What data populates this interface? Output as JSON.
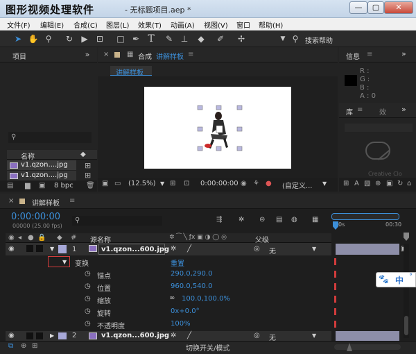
{
  "app_title": "图形视频处理软件",
  "doc_title": "- 无标题项目.aep *",
  "window_controls": {
    "minimize": "—",
    "maximize": "▢",
    "close": "✕"
  },
  "menu": [
    "文件(F)",
    "编辑(E)",
    "合成(C)",
    "图层(L)",
    "效果(T)",
    "动画(A)",
    "视图(V)",
    "窗口",
    "帮助(H)"
  ],
  "toolbar": {
    "search_help": "搜索帮助"
  },
  "project_panel": {
    "tab": "项目",
    "search_placeholder": "",
    "col_name": "名称",
    "items": [
      "v1.qzon....jpg",
      "v1.qzon....jpg"
    ],
    "bpc": "8 bpc"
  },
  "comp_panel": {
    "tab_prefix": "合成",
    "tab_name": "讲解样板",
    "sub_tab": "讲解样板",
    "zoom": "(12.5%)",
    "timecode": "0:00:00:00",
    "view": "(自定义..."
  },
  "info_panel": {
    "tab": "信息",
    "r": "R :",
    "g": "G :",
    "b": "B :",
    "a": "A : 0"
  },
  "library_panel": {
    "tab": "库",
    "tab2": "效",
    "cc_label": "Creative Clo"
  },
  "timeline": {
    "tab": "讲解样板",
    "timecode": "0:00:00:00",
    "fps": "00000 (25.00 fps)",
    "col_num": "#",
    "col_source": "源名称",
    "col_parent": "父级",
    "ruler_start": "0s",
    "ruler_end": "00:30",
    "layer1": {
      "num": "1",
      "name": "v1.qzon...600.jpg",
      "parent": "无"
    },
    "transform_label": "变换",
    "reset_label": "重置",
    "props": [
      {
        "label": "锚点",
        "value": "290.0,290.0"
      },
      {
        "label": "位置",
        "value": "960.0,540.0"
      },
      {
        "label": "缩放",
        "value": "100.0,100.0%"
      },
      {
        "label": "旋转",
        "value": "0x+0.0°"
      },
      {
        "label": "不透明度",
        "value": "100%"
      }
    ],
    "layer2": {
      "num": "2",
      "name": "v1.qzon...600.jpg",
      "parent": "无"
    },
    "footer": "切换开关/模式"
  },
  "ime": {
    "label": "中",
    "dot": "°"
  },
  "colors": {
    "accent": "#3c8fd9",
    "layer_label": "#a7a8d8",
    "ime_blue": "#2a6fc9"
  }
}
